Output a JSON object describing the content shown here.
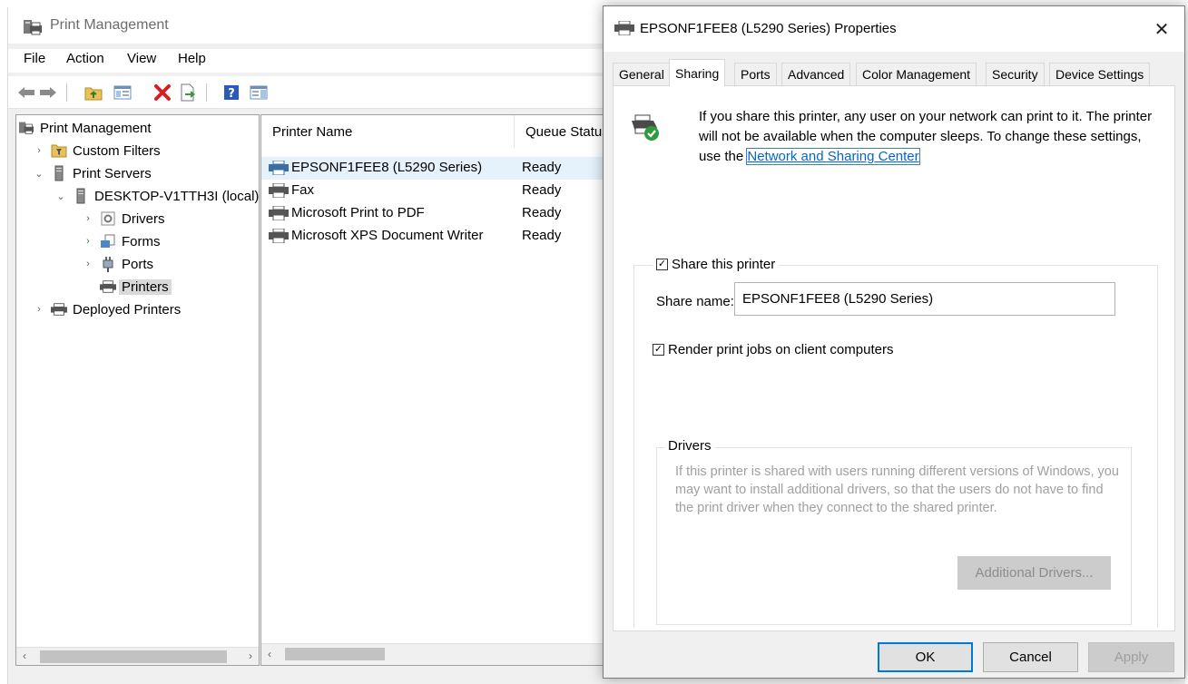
{
  "main_window": {
    "title": "Print Management",
    "menu": [
      "File",
      "Action",
      "View",
      "Help"
    ],
    "toolbar_icons": [
      "back-arrow-icon",
      "forward-arrow-icon",
      "up-folder-icon",
      "show-hide-tree-icon",
      "delete-icon",
      "export-list-icon",
      "help-icon",
      "action-pane-icon"
    ]
  },
  "tree": {
    "root": "Print Management",
    "custom_filters": "Custom Filters",
    "print_servers": "Print Servers",
    "server": "DESKTOP-V1TTH3I (local)",
    "drivers": "Drivers",
    "forms": "Forms",
    "ports": "Ports",
    "printers": "Printers",
    "deployed_printers": "Deployed Printers"
  },
  "list": {
    "columns": [
      "Printer Name",
      "Queue Status"
    ],
    "rows": [
      {
        "name": "EPSONF1FEE8 (L5290 Series)",
        "status": "Ready"
      },
      {
        "name": "Fax",
        "status": "Ready"
      },
      {
        "name": "Microsoft Print to PDF",
        "status": "Ready"
      },
      {
        "name": "Microsoft XPS Document Writer",
        "status": "Ready"
      }
    ]
  },
  "dialog": {
    "title": "EPSONF1FEE8 (L5290 Series) Properties",
    "tabs": [
      "General",
      "Sharing",
      "Ports",
      "Advanced",
      "Color Management",
      "Security",
      "Device Settings"
    ],
    "active_tab": "Sharing",
    "info_text": "If you share this printer, any user on your network can print to it. The printer will not be available when the computer sleeps. To change these settings, use the ",
    "info_link": "Network and Sharing Center",
    "share_checkbox": "Share this printer",
    "share_checked": true,
    "share_name_label": "Share name:",
    "share_name_value": "EPSONF1FEE8 (L5290 Series)",
    "render_checkbox": "Render print jobs on client computers",
    "render_checked": true,
    "drivers_title": "Drivers",
    "drivers_text": "If this printer is shared with users running different versions of Windows, you may want to install additional drivers, so that the users do not have to find the print driver when they connect to the shared printer.",
    "additional_drivers_button": "Additional Drivers...",
    "ok_button": "OK",
    "cancel_button": "Cancel",
    "apply_button": "Apply"
  },
  "colors": {
    "selection": "#e5f1fb",
    "link": "#0066cc",
    "ok_border": "#0078d7",
    "disabled_text": "#a0a0a0"
  }
}
